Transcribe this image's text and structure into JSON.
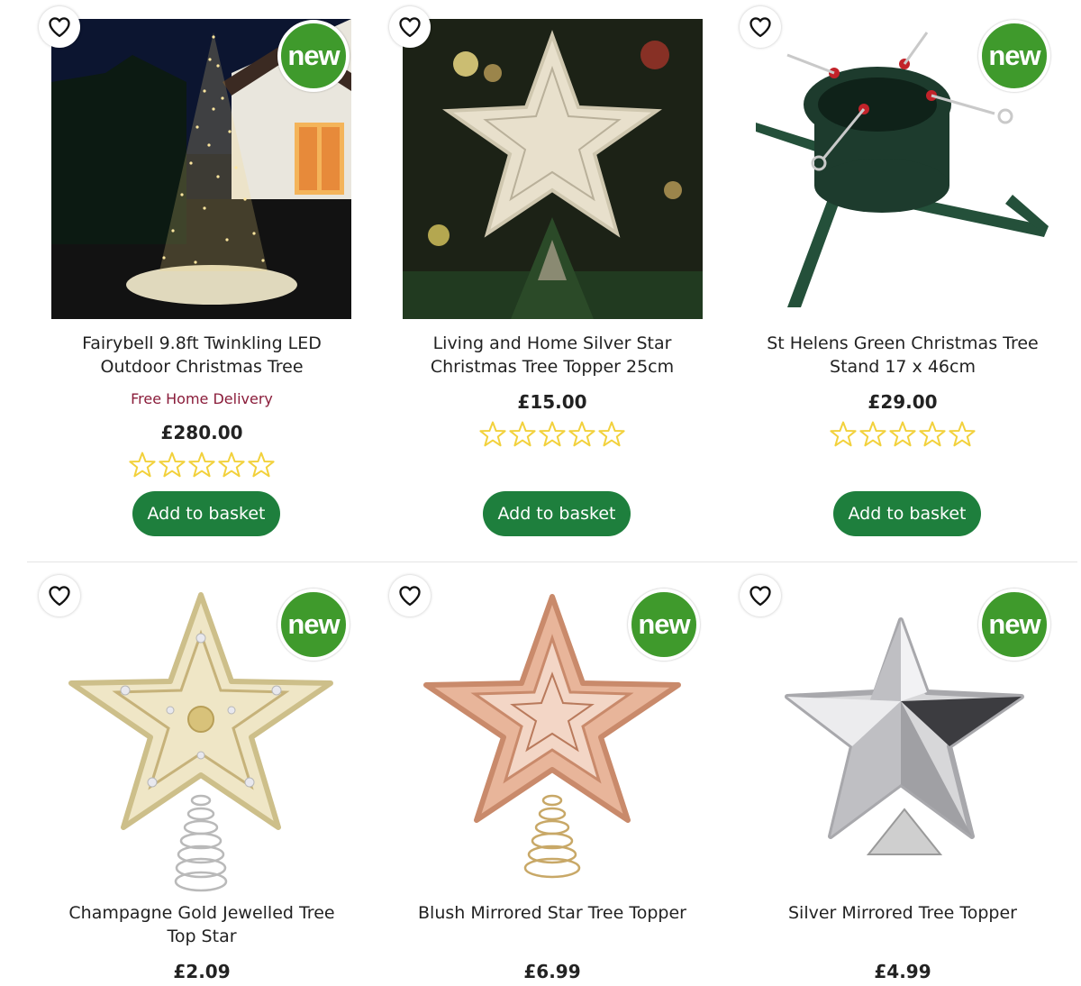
{
  "colors": {
    "accent_green": "#1e7f3d",
    "new_badge": "#3f9a2c",
    "delivery_text": "#8a1c3a",
    "star_outline": "#f2d13c"
  },
  "products": [
    {
      "title_line1": "Fairybell 9.8ft Twinkling LED",
      "title_line2": "Outdoor Christmas Tree",
      "delivery": "Free Home Delivery",
      "price": "£280.00",
      "new_badge": "new",
      "rating": 0,
      "button": "Add to basket",
      "wishlist_icon": "heart-outline-icon"
    },
    {
      "title_line1": "Living and Home Silver Star",
      "title_line2": "Christmas Tree Topper 25cm",
      "price": "£15.00",
      "rating": 0,
      "button": "Add to basket",
      "wishlist_icon": "heart-outline-icon"
    },
    {
      "title_line1": "St Helens Green Christmas Tree",
      "title_line2": "Stand 17 x 46cm",
      "price": "£29.00",
      "new_badge": "new",
      "rating": 0,
      "button": "Add to basket",
      "wishlist_icon": "heart-outline-icon"
    },
    {
      "title_line1": "Champagne Gold Jewelled Tree",
      "title_line2": "Top Star",
      "price": "£2.09",
      "new_badge": "new",
      "wishlist_icon": "heart-outline-icon"
    },
    {
      "title_line1": "Blush Mirrored Star Tree Topper",
      "title_line2": "",
      "price": "£6.99",
      "new_badge": "new",
      "wishlist_icon": "heart-outline-icon"
    },
    {
      "title_line1": "Silver Mirrored Tree Topper",
      "title_line2": "",
      "price": "£4.99",
      "new_badge": "new",
      "wishlist_icon": "heart-outline-icon"
    }
  ]
}
